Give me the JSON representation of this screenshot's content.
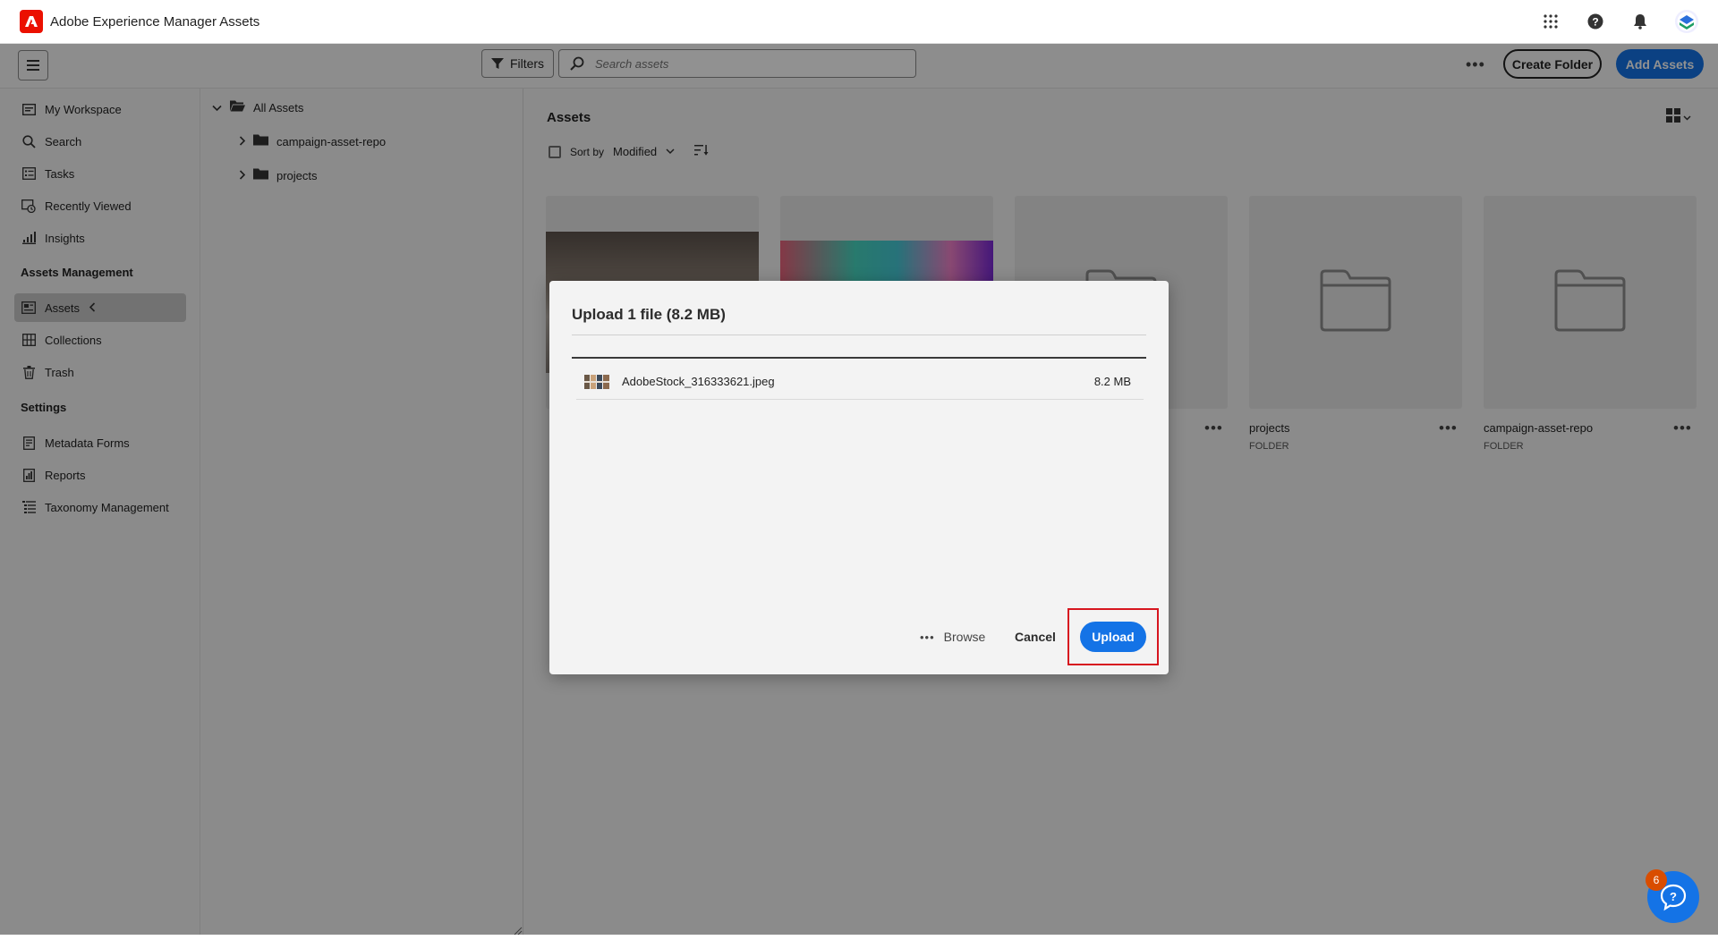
{
  "app": {
    "title": "Adobe Experience Manager Assets"
  },
  "toolbar": {
    "filters_label": "Filters",
    "search_placeholder": "Search assets",
    "create_folder_label": "Create Folder",
    "add_assets_label": "Add Assets"
  },
  "sidebar": {
    "top_items": [
      {
        "label": "My Workspace",
        "icon": "workspace-icon"
      },
      {
        "label": "Search",
        "icon": "search-icon"
      },
      {
        "label": "Tasks",
        "icon": "tasks-icon"
      },
      {
        "label": "Recently Viewed",
        "icon": "recently-viewed-icon"
      },
      {
        "label": "Insights",
        "icon": "insights-icon"
      }
    ],
    "section_assets_management": "Assets Management",
    "assets_items": [
      {
        "label": "Assets",
        "icon": "assets-icon",
        "active": true
      },
      {
        "label": "Collections",
        "icon": "collections-icon"
      },
      {
        "label": "Trash",
        "icon": "trash-icon"
      }
    ],
    "section_settings": "Settings",
    "settings_items": [
      {
        "label": "Metadata Forms",
        "icon": "metadata-forms-icon"
      },
      {
        "label": "Reports",
        "icon": "reports-icon"
      },
      {
        "label": "Taxonomy Management",
        "icon": "taxonomy-icon"
      }
    ]
  },
  "tree": {
    "root_label": "All Assets",
    "children": [
      "campaign-asset-repo",
      "projects"
    ]
  },
  "main": {
    "title": "Assets",
    "sort_by_label": "Sort by",
    "sort_value": "Modified",
    "cards": [
      {
        "name": "projects",
        "type": "FOLDER"
      },
      {
        "name": "campaign-asset-repo",
        "type": "FOLDER"
      }
    ]
  },
  "dialog": {
    "title": "Upload 1 file (8.2 MB)",
    "file": {
      "name": "AdobeStock_316333621.jpeg",
      "size": "8.2 MB"
    },
    "browse_label": "Browse",
    "cancel_label": "Cancel",
    "upload_label": "Upload"
  },
  "help": {
    "badge_count": "6"
  },
  "colors": {
    "accent": "#1473e6",
    "brand": "#eb1000",
    "highlight": "#d7161f",
    "badge": "#d94d00"
  }
}
